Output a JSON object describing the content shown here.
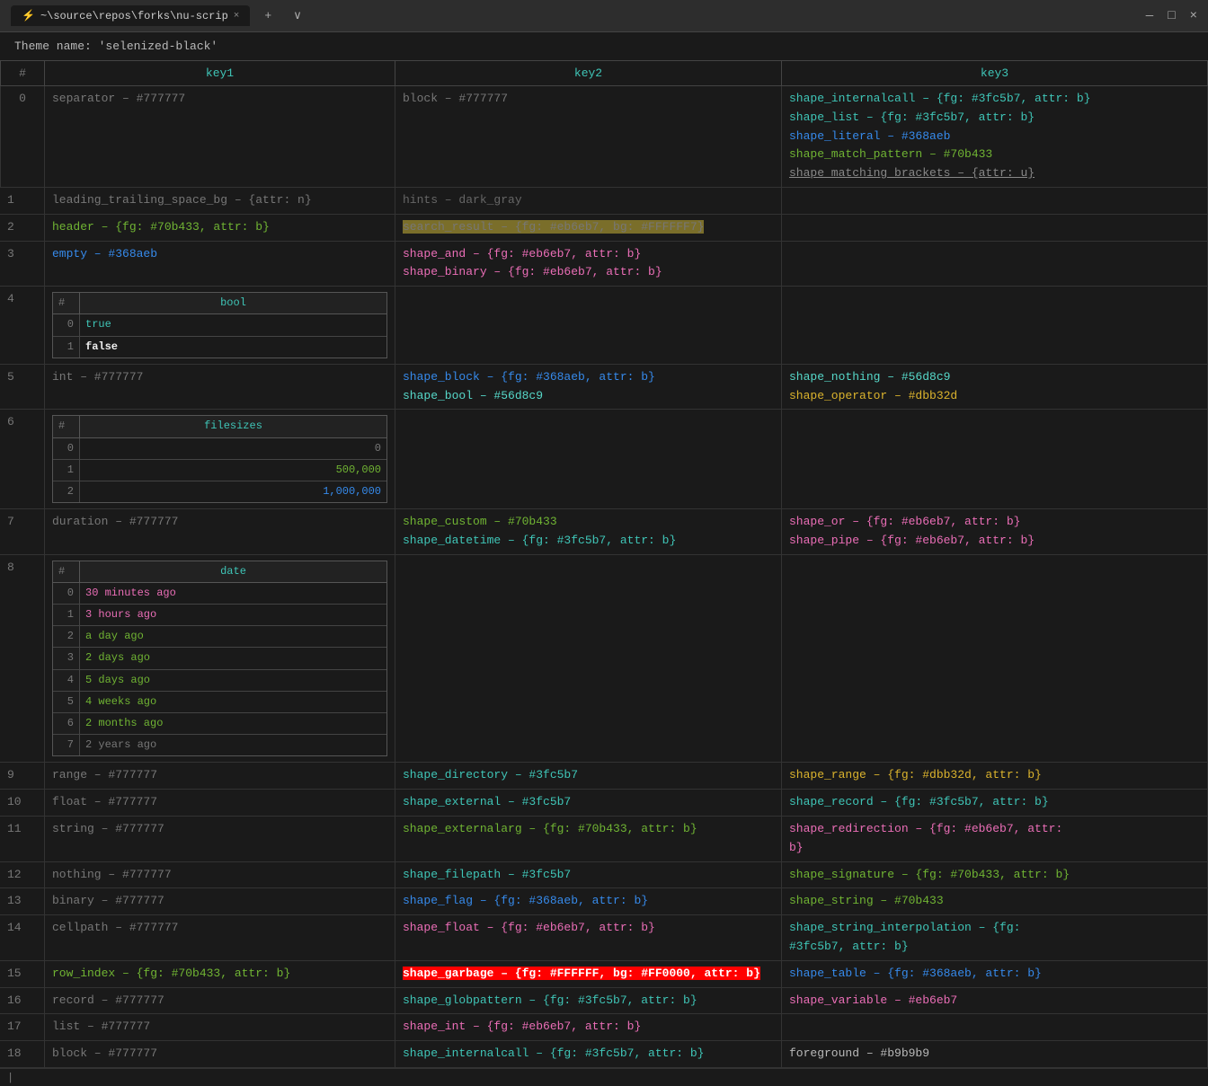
{
  "titlebar": {
    "tab_label": "~\\source\\repos\\forks\\nu-scrip",
    "close_icon": "×",
    "new_tab_icon": "+",
    "dropdown_icon": "∨",
    "minimize_icon": "—",
    "restore_icon": "□",
    "close_window_icon": "×"
  },
  "theme_line": "Theme name: 'selenized-black'",
  "table": {
    "headers": [
      "#",
      "key1",
      "key2",
      "key3"
    ],
    "rows": [
      {
        "index": "0",
        "key1": "separator – #777777",
        "key1_color": "777",
        "key2": "block – #777777",
        "key2_color": "777",
        "key3_parts": [
          {
            "text": "shape_internalcall – {fg: #3fc5b7, attr: b}",
            "color": "3fc5b7"
          },
          {
            "text": "shape_list – {fg: #3fc5b7, attr: b}",
            "color": "3fc5b7"
          },
          {
            "text": "shape_literal – #368aeb",
            "color": "368aeb"
          },
          {
            "text": "shape_match_pattern – #70b433",
            "color": "70b433"
          },
          {
            "text": "shape_matching_brackets – {attr: u}",
            "color": "strikethrough-underline"
          }
        ]
      },
      {
        "index": "1",
        "key1": "leading_trailing_space_bg – {attr: n}",
        "key1_color": "777",
        "key2_special": "hints – dark_gray",
        "key2_color": "dark_gray",
        "key3": ""
      },
      {
        "index": "2",
        "key1": "header – {fg: #70b433, attr: b}",
        "key1_color": "70b433",
        "key2_highlight": "search_result – {fg: #eb6eb7, bg: #FFFFFF7}",
        "key3": ""
      },
      {
        "index": "3",
        "key1": "empty – #368aeb",
        "key1_color": "368aeb",
        "key2_parts": [
          {
            "text": "shape_and – {fg: #eb6eb7, attr: b}",
            "color": "eb6eb7"
          },
          {
            "text": "shape_binary – {fg: #eb6eb7, attr: b}",
            "color": "eb6eb7"
          }
        ],
        "key3": ""
      }
    ]
  }
}
